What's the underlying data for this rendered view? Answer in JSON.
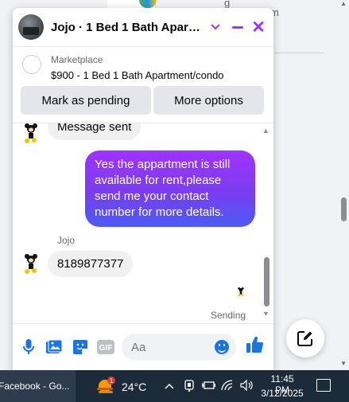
{
  "background": {
    "text_line1": "g",
    "text_line2": "m"
  },
  "chat": {
    "title": "Jojo · 1 Bed 1 Bath Apartm...",
    "accent_color": "#a033ff",
    "listing": {
      "label": "Marketplace",
      "title": "$900 - 1 Bed 1 Bath Apartment/condo",
      "mark_pending_label": "Mark as pending",
      "more_options_label": "More options"
    },
    "messages": {
      "partial_in": "Message sent",
      "outgoing": "Yes the appartment is still available for rent,please send me your contact number for more details.",
      "sender_name": "Jojo",
      "incoming": "8189877377",
      "status": "Sending"
    },
    "composer": {
      "placeholder": "Aa",
      "icons": [
        "mic-icon",
        "photo-icon",
        "sticker-icon",
        "gif-icon",
        "emoji-icon",
        "thumbs-up-icon"
      ],
      "gif_label": "GIF"
    }
  },
  "taskbar": {
    "app_label": "Facebook - Go...",
    "temperature": "24°C",
    "weather_badge": "1",
    "time": "11:45 PM",
    "date": "3/12/2025"
  }
}
